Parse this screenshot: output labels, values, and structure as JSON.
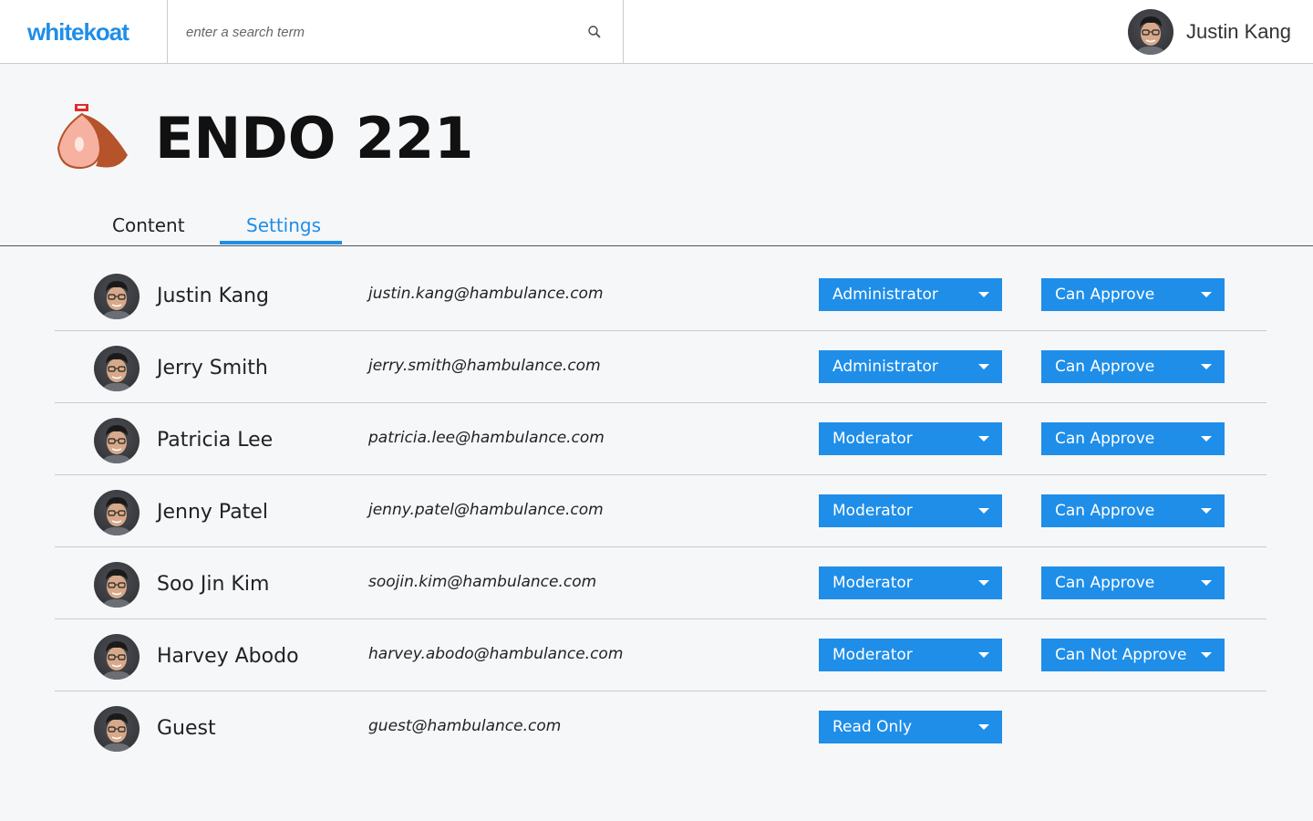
{
  "header": {
    "logo": "whitekoat",
    "search_placeholder": "enter a search term",
    "search_icon": "search-icon",
    "user_name": "Justin Kang"
  },
  "course": {
    "title": "ENDO 221",
    "icon": "course-icon"
  },
  "tabs": [
    {
      "label": "Content",
      "active": false
    },
    {
      "label": "Settings",
      "active": true
    }
  ],
  "colors": {
    "accent": "#1f8ee8",
    "background": "#f6f7f9"
  },
  "members": [
    {
      "name": "Justin Kang",
      "email": "justin.kang@hambulance.com",
      "role": "Administrator",
      "permission": "Can Approve"
    },
    {
      "name": "Jerry Smith",
      "email": "jerry.smith@hambulance.com",
      "role": "Administrator",
      "permission": "Can Approve"
    },
    {
      "name": "Patricia Lee",
      "email": "patricia.lee@hambulance.com",
      "role": "Moderator",
      "permission": "Can Approve"
    },
    {
      "name": "Jenny Patel",
      "email": "jenny.patel@hambulance.com",
      "role": "Moderator",
      "permission": "Can Approve"
    },
    {
      "name": "Soo Jin Kim",
      "email": "soojin.kim@hambulance.com",
      "role": "Moderator",
      "permission": "Can Approve"
    },
    {
      "name": "Harvey Abodo",
      "email": "harvey.abodo@hambulance.com",
      "role": "Moderator",
      "permission": "Can Not Approve"
    },
    {
      "name": "Guest",
      "email": "guest@hambulance.com",
      "role": "Read Only",
      "permission": null
    }
  ]
}
